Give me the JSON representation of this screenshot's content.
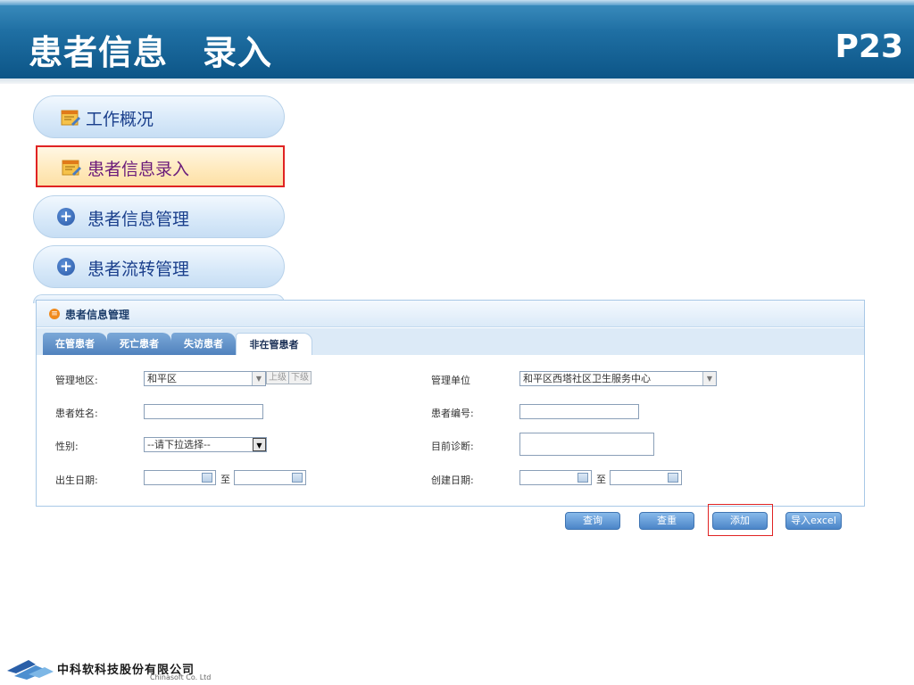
{
  "slide": {
    "title": "患者信息　录入",
    "page_number": "P23"
  },
  "menu": {
    "items": [
      {
        "label": "工作概况",
        "icon": "note-edit-icon"
      },
      {
        "label": "患者信息录入",
        "icon": "note-edit-icon",
        "active": true
      },
      {
        "label": "患者信息管理",
        "icon": "plus-circle-icon"
      },
      {
        "label": "患者流转管理",
        "icon": "plus-circle-icon"
      }
    ]
  },
  "panel": {
    "title": "患者信息管理",
    "tabs": [
      "在管患者",
      "死亡患者",
      "失访患者",
      "非在管患者"
    ],
    "selected_tab": "非在管患者",
    "form": {
      "region_label": "管理地区:",
      "region_value": "和平区",
      "level_up": "上级",
      "level_down": "下级",
      "unit_label": "管理单位",
      "unit_value": "和平区西塔社区卫生服务中心",
      "name_label": "患者姓名:",
      "name_value": "",
      "code_label": "患者编号:",
      "code_value": "",
      "gender_label": "性别:",
      "gender_value": "--请下拉选择--",
      "diagnosis_label": "目前诊断:",
      "diagnosis_value": "",
      "birth_label": "出生日期:",
      "create_label": "创建日期:",
      "range_sep": "至"
    }
  },
  "actions": {
    "query": "查询",
    "reset": "查重",
    "add": "添加",
    "import": "导入excel"
  },
  "footer": {
    "company_cn": "中科软科技股份有限公司",
    "company_en": "Chinasoft Co. Ltd"
  },
  "colors": {
    "header_blue": "#1f6fa3",
    "highlight_red": "#e02323",
    "button_blue": "#4b85c8"
  }
}
